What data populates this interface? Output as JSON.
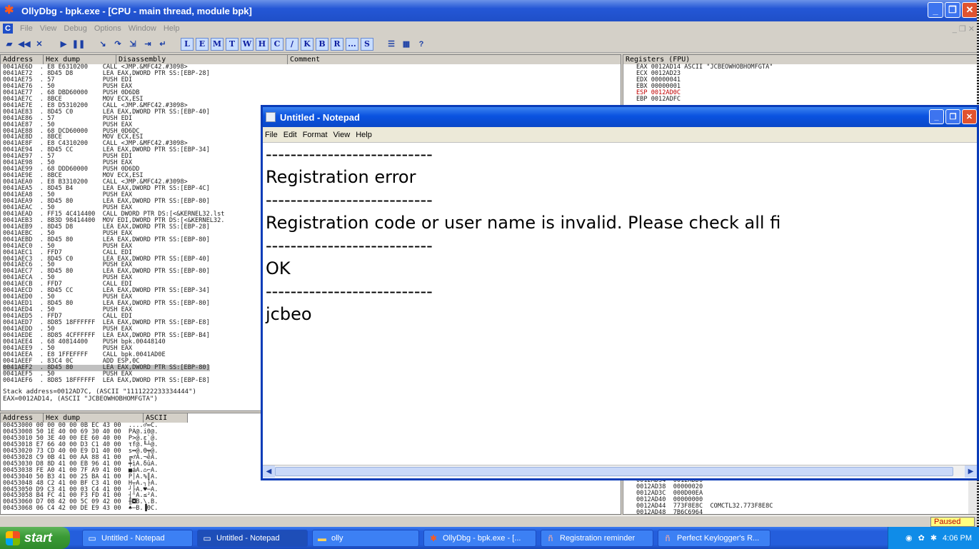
{
  "olly": {
    "title": "OllyDbg - bpk.exe - [CPU - main thread, module bpk]",
    "menu": [
      "File",
      "View",
      "Debug",
      "Options",
      "Window",
      "Help"
    ],
    "toolbar_letters": [
      "L",
      "E",
      "M",
      "T",
      "W",
      "H",
      "C",
      "/",
      "K",
      "B",
      "R",
      "...",
      "S"
    ],
    "headers": {
      "address": "Address",
      "hexdump": "Hex dump",
      "disassembly": "Disassembly",
      "comment": "Comment",
      "registers": "Registers (FPU)",
      "address2": "Address",
      "hexdump2": "Hex dump",
      "ascii": "ASCII"
    },
    "disasm": [
      "0041AE6D  . E8 E6310200    CALL <JMP.&MFC42.#3098>",
      "0041AE72  . 8D45 D8        LEA EAX,DWORD PTR SS:[EBP-28]",
      "0041AE75  . 57             PUSH EDI",
      "0041AE76  . 50             PUSH EAX",
      "0041AE77  . 68 DBD60000    PUSH 0D6DB",
      "0041AE7C  . 8BCE           MOV ECX,ESI",
      "0041AE7E  . E8 D5310200    CALL <JMP.&MFC42.#3098>",
      "0041AE83  . 8D45 C0        LEA EAX,DWORD PTR SS:[EBP-40]",
      "0041AE86  . 57             PUSH EDI",
      "0041AE87  . 50             PUSH EAX",
      "0041AE88  . 68 DCD60000    PUSH 0D6DC",
      "0041AE8D  . 8BCE           MOV ECX,ESI",
      "0041AE8F  . E8 C4310200    CALL <JMP.&MFC42.#3098>",
      "0041AE94  . 8D45 CC        LEA EAX,DWORD PTR SS:[EBP-34]",
      "0041AE97  . 57             PUSH EDI",
      "0041AE98  . 50             PUSH EAX",
      "0041AE99  . 68 DDD60000    PUSH 0D6DD",
      "0041AE9E  . 8BCE           MOV ECX,ESI",
      "0041AEA0  . E8 B3310200    CALL <JMP.&MFC42.#3098>",
      "0041AEA5  . 8D45 B4        LEA EAX,DWORD PTR SS:[EBP-4C]",
      "0041AEA8  . 50             PUSH EAX",
      "0041AEA9  . 8D45 80        LEA EAX,DWORD PTR SS:[EBP-80]",
      "0041AEAC  . 50             PUSH EAX",
      "0041AEAD  . FF15 4C414400  CALL DWORD PTR DS:[<&KERNEL32.lst",
      "0041AEB3  . 8B3D 98414400  MOV EDI,DWORD PTR DS:[<&KERNEL32.",
      "0041AEB9  . 8D45 D8        LEA EAX,DWORD PTR SS:[EBP-28]",
      "0041AEBC  . 50             PUSH EAX",
      "0041AEBD  . 8D45 80        LEA EAX,DWORD PTR SS:[EBP-80]",
      "0041AEC0  . 50             PUSH EAX",
      "0041AEC1  . FFD7           CALL EDI",
      "0041AEC3  . 8D45 C0        LEA EAX,DWORD PTR SS:[EBP-40]",
      "0041AEC6  . 50             PUSH EAX",
      "0041AEC7  . 8D45 80        LEA EAX,DWORD PTR SS:[EBP-80]",
      "0041AECA  . 50             PUSH EAX",
      "0041AECB  . FFD7           CALL EDI",
      "0041AECD  . 8D45 CC        LEA EAX,DWORD PTR SS:[EBP-34]",
      "0041AED0  . 50             PUSH EAX",
      "0041AED1  . 8D45 80        LEA EAX,DWORD PTR SS:[EBP-80]",
      "0041AED4  . 50             PUSH EAX",
      "0041AED5  . FFD7           CALL EDI",
      "0041AED7  . 8D85 18FFFFFF  LEA EAX,DWORD PTR SS:[EBP-E8]",
      "0041AEDD  . 50             PUSH EAX",
      "0041AEDE  . 8D85 4CFFFFFF  LEA EAX,DWORD PTR SS:[EBP-B4]",
      "0041AEE4  . 68 40814400    PUSH bpk.00448140",
      "0041AEE9  . 50             PUSH EAX",
      "0041AEEA  . E8 1FFEFFFF    CALL bpk.0041AD0E",
      "0041AEEF  . 83C4 0C        ADD ESP,0C",
      "0041AEF2  . 8D45 80        LEA EAX,DWORD PTR SS:[EBP-80]",
      "0041AEF5  . 50             PUSH EAX",
      "0041AEF6  . 8D85 18FFFFFF  LEA EAX,DWORD PTR SS:[EBP-E8]"
    ],
    "info_lines": [
      "Stack address=0012AD7C, (ASCII \"1111222233334444\")",
      "EAX=0012AD14, (ASCII \"JCBEOWHOBHOMFGTA\")"
    ],
    "registers": [
      "EAX 0012AD14 ASCII \"JCBEOWHOBHOMFGTA\"",
      "ECX 0012AD23",
      "EDX 00000041",
      "EBX 00000001",
      "ESP 0012AD0C",
      "EBP 0012ADFC"
    ],
    "dump": [
      "00453000 00 00 00 00 0B EC 43 00  ....♂∞C.",
      "00453008 50 1E 40 00 69 30 40 00  PA@.i0@.",
      "00453010 50 3E 40 00 EE 60 40 00  P>@.ε`@.",
      "00453018 E7 66 40 00 D3 C1 40 00  τf@.╙┴@.",
      "00453020 73 CD 40 00 E9 D1 40 00  s═@.Θ╤@.",
      "00453028 C9 0B 41 00 AA 88 41 00  ╔♂A.¬êA.",
      "00453030 D8 8D 41 00 EB 96 41 00  ╪ìA.δûA.",
      "00453038 FE A0 41 00 7F A9 41 00  ■áA.⌂⌐A.",
      "00453040 50 B3 41 00 25 BA 41 00  P│A.%║A.",
      "00453048 48 C2 41 00 BF C3 41 00  H┬A.┐├A.",
      "00453050 D9 C3 41 00 03 C4 41 00  ┘├A.♥─A.",
      "00453058 B4 FC 41 00 F3 FD 41 00  ┤ⁿA.≤²A.",
      "00453060 D7 08 42 00 5C 09 42 00  ╫◘B.\\.B.",
      "00453068 06 C4 42 00 DE E9 43 00  ♠─B.▐ΘC."
    ],
    "stack": [
      "0012AD34  0012ADD0",
      "0012AD38  00000020",
      "0012AD3C  000D00EA",
      "0012AD40  00000000",
      "0012AD44  773F8E8C  COMCTL32.773F8E8C",
      "0012AD48  7B6C6964"
    ],
    "status": "Paused"
  },
  "notepad": {
    "title": "Untitled - Notepad",
    "menu": [
      "File",
      "Edit",
      "Format",
      "View",
      "Help"
    ],
    "lines": [
      "---------------------------",
      "Registration error",
      "---------------------------",
      "Registration code or user name is invalid. Please check all fi",
      "---------------------------",
      "OK",
      "---------------------------",
      "jcbeo"
    ]
  },
  "taskbar": {
    "start": "start",
    "tasks": [
      "Untitled - Notepad",
      "Untitled - Notepad",
      "olly",
      "OllyDbg - bpk.exe - [...",
      "Registration reminder",
      "Perfect Keylogger's R..."
    ],
    "time": "4:06 PM"
  }
}
